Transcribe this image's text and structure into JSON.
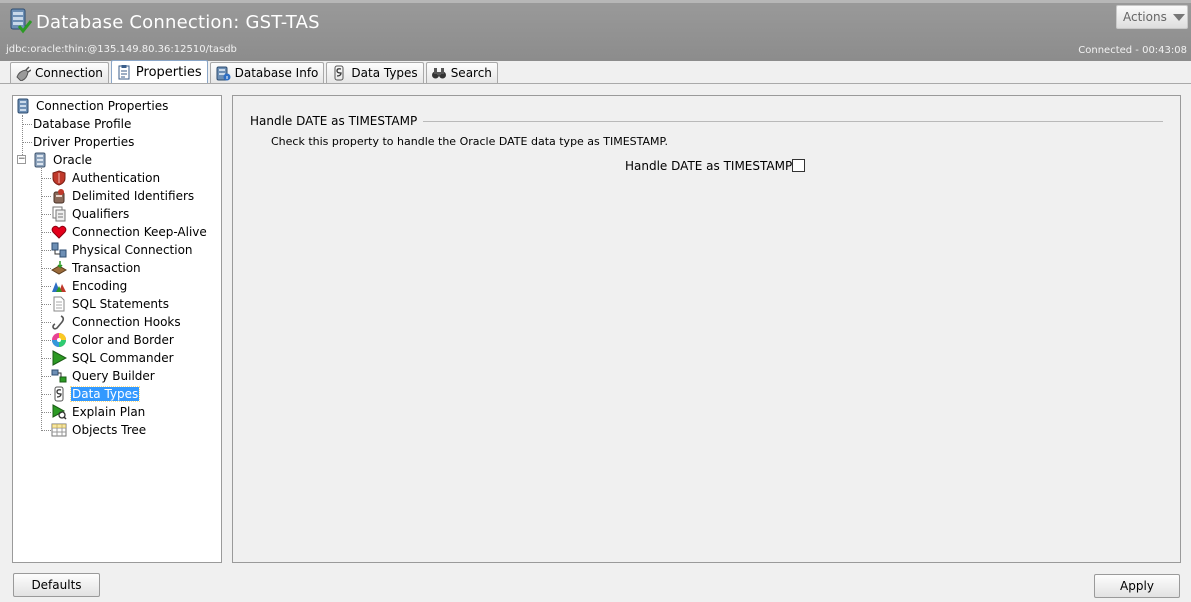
{
  "header": {
    "title": "Database Connection: GST-TAS",
    "url": "jdbc:oracle:thin:@135.149.80.36:12510/tasdb",
    "status": "Connected - 00:43:08",
    "actions_label": "Actions"
  },
  "tabs": [
    {
      "label": "Connection",
      "icon": "plug-icon"
    },
    {
      "label": "Properties",
      "icon": "clipboard-icon",
      "active": true
    },
    {
      "label": "Database Info",
      "icon": "database-info-icon"
    },
    {
      "label": "Data Types",
      "icon": "data-types-icon"
    },
    {
      "label": "Search",
      "icon": "binoculars-icon"
    }
  ],
  "tree": {
    "root": {
      "label": "Connection Properties",
      "icon": "database-icon"
    },
    "items": [
      {
        "label": "Database Profile",
        "level": 1
      },
      {
        "label": "Driver Properties",
        "level": 1
      },
      {
        "label": "Oracle",
        "level": 1,
        "icon": "oracle-db-icon",
        "expanded": true
      },
      {
        "label": "Authentication",
        "level": 2,
        "icon": "shield-icon"
      },
      {
        "label": "Delimited Identifiers",
        "level": 2,
        "icon": "quote-db-icon"
      },
      {
        "label": "Qualifiers",
        "level": 2,
        "icon": "qualifiers-icon"
      },
      {
        "label": "Connection Keep-Alive",
        "level": 2,
        "icon": "heart-icon"
      },
      {
        "label": "Physical Connection",
        "level": 2,
        "icon": "network-icon"
      },
      {
        "label": "Transaction",
        "level": 2,
        "icon": "transaction-icon"
      },
      {
        "label": "Encoding",
        "level": 2,
        "icon": "encoding-icon"
      },
      {
        "label": "SQL Statements",
        "level": 2,
        "icon": "document-icon"
      },
      {
        "label": "Connection Hooks",
        "level": 2,
        "icon": "hook-icon"
      },
      {
        "label": "Color and Border",
        "level": 2,
        "icon": "color-wheel-icon"
      },
      {
        "label": "SQL Commander",
        "level": 2,
        "icon": "play-icon"
      },
      {
        "label": "Query Builder",
        "level": 2,
        "icon": "query-builder-icon"
      },
      {
        "label": "Data Types",
        "level": 2,
        "icon": "data-types-icon",
        "selected": true
      },
      {
        "label": "Explain Plan",
        "level": 2,
        "icon": "explain-plan-icon"
      },
      {
        "label": "Objects Tree",
        "level": 2,
        "icon": "grid-icon"
      }
    ]
  },
  "content": {
    "section_title": "Handle DATE as TIMESTAMP",
    "description": "Check this property to handle the Oracle DATE data type as TIMESTAMP.",
    "property_label": "Handle DATE as TIMESTAMP:",
    "property_checked": false
  },
  "buttons": {
    "defaults": "Defaults",
    "apply": "Apply"
  }
}
